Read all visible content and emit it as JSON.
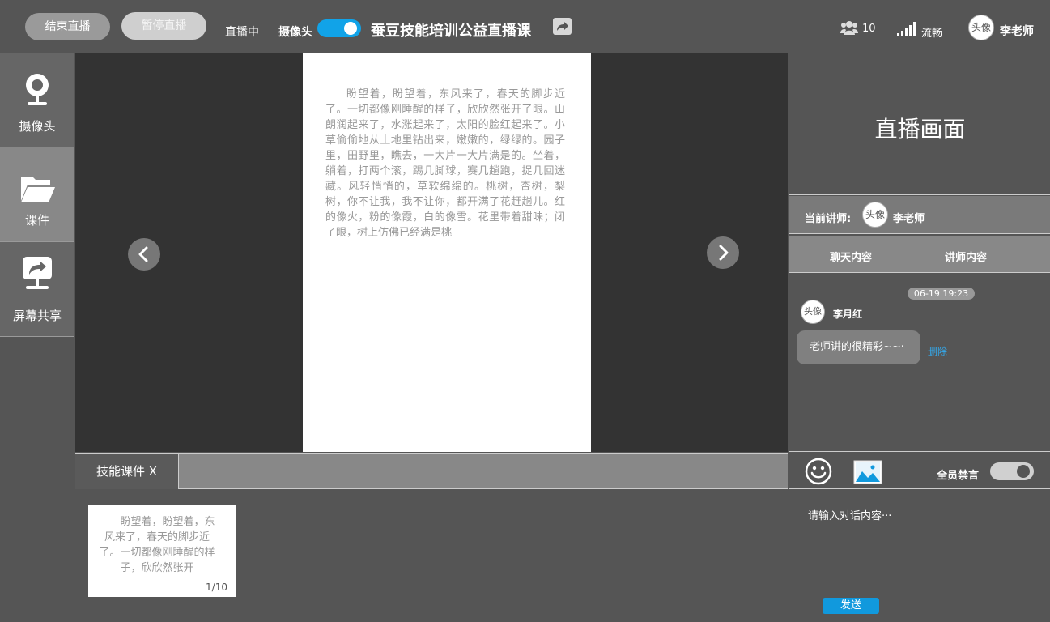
{
  "topbar": {
    "end_live": "结束直播",
    "pause_live": "暂停直播",
    "live_status": "直播中",
    "camera_label": "摄像头",
    "camera_on": true,
    "course_title": "蚕豆技能培训公益直播课",
    "viewer_count": "10",
    "network_status": "流畅",
    "avatar_text": "头像",
    "teacher_name": "李老师"
  },
  "sidebar": {
    "items": [
      {
        "label": "摄像头",
        "icon": "webcam-icon"
      },
      {
        "label": "课件",
        "icon": "folder-open-icon"
      },
      {
        "label": "屏幕共享",
        "icon": "screen-share-icon"
      }
    ],
    "active_index": 1
  },
  "stage": {
    "doc_text": "盼望着，盼望着，东风来了，春天的脚步近了。一切都像刚睡醒的样子，欣欣然张开了眼。山朗润起来了，水涨起来了，太阳的脸红起来了。小草偷偷地从土地里钻出来，嫩嫩的，绿绿的。园子里，田野里，瞧去，一大片一大片满是的。坐着，躺着，打两个滚，踢几脚球，赛几趟跑，捉几回迷藏。风轻悄悄的，草软绵绵的。桃树，杏树，梨树，你不让我，我不让你，都开满了花赶趟儿。红的像火，粉的像霞，白的像雪。花里带着甜味；闭了眼，树上仿佛已经满是桃"
  },
  "courseware": {
    "tab_label": "技能课件 X",
    "thumb_text": "盼望着，盼望着，东风来了，春天的脚步近了。一切都像刚睡醒的样子，欣欣然张开",
    "page_indicator": "1/10"
  },
  "right_panel": {
    "live_screen_title": "直播画面",
    "current_teacher_label": "当前讲师:",
    "current_teacher_avatar": "头像",
    "current_teacher_name": "李老师",
    "tabs": [
      "聊天内容",
      "讲师内容"
    ],
    "messages": [
      {
        "time": "06-19 19:23",
        "avatar": "头像",
        "user": "李月红",
        "text": "老师讲的很精彩~~·",
        "action": "删除"
      }
    ],
    "mute_all_label": "全员禁言",
    "mute_all_on": true,
    "input_placeholder": "请输入对话内容···",
    "send_label": "发送"
  },
  "colors": {
    "accent": "#11a3e8",
    "link": "#33aaee",
    "background": "#555555"
  }
}
